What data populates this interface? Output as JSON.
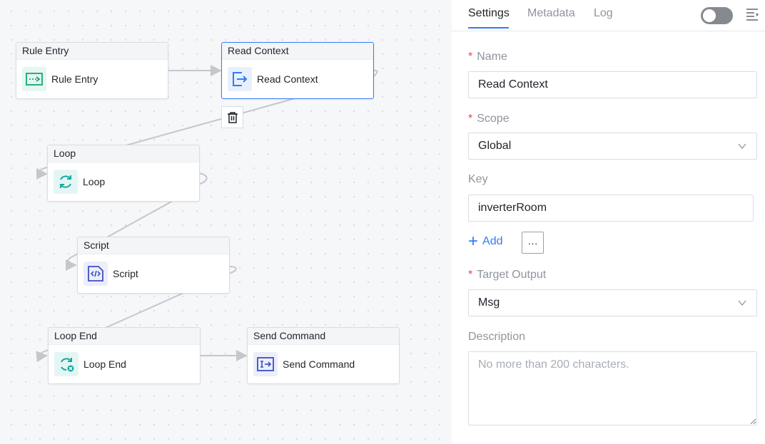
{
  "canvas": {
    "nodes": [
      {
        "id": "rule-entry",
        "header": "Rule Entry",
        "label": "Rule Entry",
        "icon": "import-icon"
      },
      {
        "id": "read-context",
        "header": "Read Context",
        "label": "Read Context",
        "icon": "export-icon",
        "selected": true
      },
      {
        "id": "loop",
        "header": "Loop",
        "label": "Loop",
        "icon": "loop-icon"
      },
      {
        "id": "script",
        "header": "Script",
        "label": "Script",
        "icon": "code-file-icon"
      },
      {
        "id": "loop-end",
        "header": "Loop End",
        "label": "Loop End",
        "icon": "loop-end-icon"
      },
      {
        "id": "send-command",
        "header": "Send Command",
        "label": "Send Command",
        "icon": "send-command-icon"
      }
    ],
    "delete_button_icon": "trash-icon"
  },
  "panel": {
    "tabs": [
      {
        "label": "Settings",
        "active": true
      },
      {
        "label": "Metadata",
        "active": false
      },
      {
        "label": "Log",
        "active": false
      }
    ],
    "toggle_on": false,
    "name": {
      "required_mark": "*",
      "label": "Name",
      "value": "Read Context"
    },
    "scope": {
      "required_mark": "*",
      "label": "Scope",
      "value": "Global"
    },
    "key": {
      "label": "Key",
      "value": "inverterRoom"
    },
    "add": {
      "icon": "plus-icon",
      "label": "Add"
    },
    "more": {
      "label": "···"
    },
    "target_output": {
      "required_mark": "*",
      "label": "Target Output",
      "value": "Msg"
    },
    "description": {
      "label": "Description",
      "placeholder": "No more than 200 characters."
    }
  },
  "colors": {
    "accent": "#2f7cf6",
    "required": "#e5484d",
    "edge": "#c4c7cc",
    "icon_green": "#17a672",
    "icon_blue": "#2f7cf6",
    "icon_teal": "#17a7a0",
    "icon_indigo": "#3b4fc4"
  }
}
